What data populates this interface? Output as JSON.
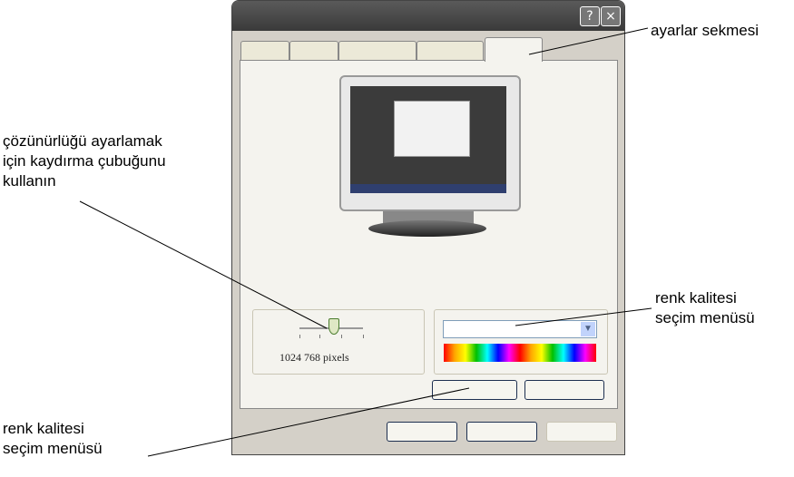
{
  "callouts": {
    "settings_tab": "ayarlar sekmesi",
    "resolution": [
      "çözünürlüğü ayarlamak",
      "için kaydırma çubuğunu",
      "kullanın"
    ],
    "color_quality_right": [
      "renk kalitesi",
      "seçim menüsü"
    ],
    "color_quality_bottom": [
      "renk kalitesi",
      "seçim menüsü"
    ]
  },
  "titlebar": {
    "help_icon": "?",
    "close_icon": "×"
  },
  "resolution": {
    "label": "1024   768 pixels",
    "value_fraction": 0.45
  },
  "colors": {
    "accent": "#4a7c2e",
    "titlebar": "#4a4a4a",
    "dialog_bg": "#d4d0c8"
  }
}
